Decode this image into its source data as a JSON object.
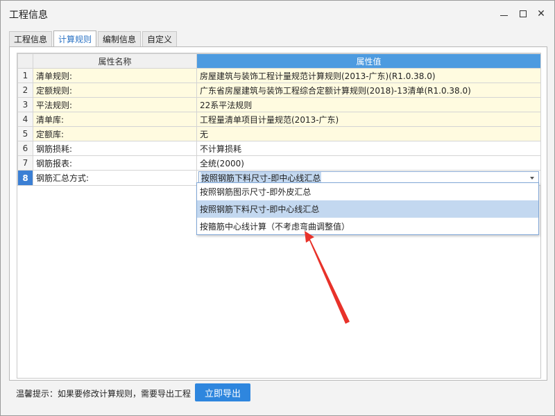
{
  "window": {
    "title": "工程信息",
    "close_glyph": "✕"
  },
  "tabs": [
    {
      "label": "工程信息"
    },
    {
      "label": "计算规则"
    },
    {
      "label": "编制信息"
    },
    {
      "label": "自定义"
    }
  ],
  "active_tab": 1,
  "grid": {
    "headers": {
      "name": "属性名称",
      "value": "属性值"
    },
    "rows": [
      {
        "idx": "1",
        "name": "清单规则:",
        "value": "房屋建筑与装饰工程计量规范计算规则(2013-广东)(R1.0.38.0)"
      },
      {
        "idx": "2",
        "name": "定额规则:",
        "value": "广东省房屋建筑与装饰工程综合定额计算规则(2018)-13清单(R1.0.38.0)"
      },
      {
        "idx": "3",
        "name": "平法规则:",
        "value": "22系平法规则"
      },
      {
        "idx": "4",
        "name": "清单库:",
        "value": "工程量清单项目计量规范(2013-广东)"
      },
      {
        "idx": "5",
        "name": "定额库:",
        "value": "无"
      },
      {
        "idx": "6",
        "name": "钢筋损耗:",
        "value": "不计算损耗"
      },
      {
        "idx": "7",
        "name": "钢筋报表:",
        "value": "全统(2000)"
      },
      {
        "idx": "8",
        "name": "钢筋汇总方式:",
        "value": "按照钢筋下料尺寸-即中心线汇总"
      }
    ]
  },
  "dropdown": {
    "options": [
      "按照钢筋图示尺寸-即外皮汇总",
      "按照钢筋下料尺寸-即中心线汇总",
      "按箍筋中心线计算（不考虑弯曲调整值）"
    ],
    "highlighted": 1
  },
  "footer": {
    "tip": "温馨提示：如果要修改计算规则，需要导出工程",
    "export_label": "立即导出"
  },
  "colors": {
    "accent": "#2e86de",
    "header_value_bg": "#4d9be0",
    "highlight_row": "#fffbe0",
    "annotation_arrow": "#e8322a"
  }
}
